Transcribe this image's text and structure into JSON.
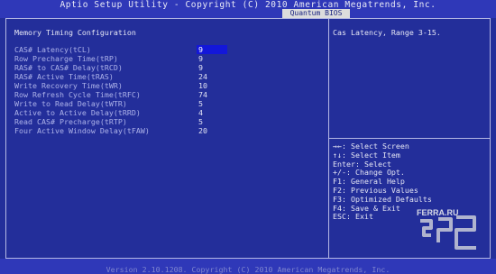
{
  "header": {
    "title": "Aptio Setup Utility - Copyright (C) 2010 American Megatrends, Inc.",
    "active_tab": "Quantum BIOS"
  },
  "section_title": "Memory Timing Configuration",
  "settings": [
    {
      "label": "CAS# Latency(tCL)",
      "value": "9"
    },
    {
      "label": "Row Precharge Time(tRP)",
      "value": "9"
    },
    {
      "label": "RAS# to CAS# Delay(tRCD)",
      "value": "9"
    },
    {
      "label": "RAS# Active Time(tRAS)",
      "value": "24"
    },
    {
      "label": "Write Recovery Time(tWR)",
      "value": "10"
    },
    {
      "label": "Row Refresh Cycle Time(tRFC)",
      "value": "74"
    },
    {
      "label": "Write to Read Delay(tWTR)",
      "value": "5"
    },
    {
      "label": "Active to Active Delay(tRRD)",
      "value": "4"
    },
    {
      "label": "Read CAS# Precharge(tRTP)",
      "value": "5"
    },
    {
      "label": "Four Active Window Delay(tFAW)",
      "value": "20"
    }
  ],
  "help_text": "Cas Latency, Range 3-15.",
  "key_help": [
    "→←: Select Screen",
    "↑↓: Select Item",
    "Enter: Select",
    "+/-: Change Opt.",
    "F1: General Help",
    "F2: Previous Values",
    "F3: Optimized Defaults",
    "F4: Save & Exit",
    "ESC: Exit"
  ],
  "footer": "Version 2.10.1208. Copyright (C) 2010 American Megatrends, Inc.",
  "watermark": "FERRA.RU",
  "colors": {
    "background": "#232e9a",
    "bars": "#2f38b8",
    "selection": "#1317d9",
    "tab": "#dcdcdc"
  }
}
